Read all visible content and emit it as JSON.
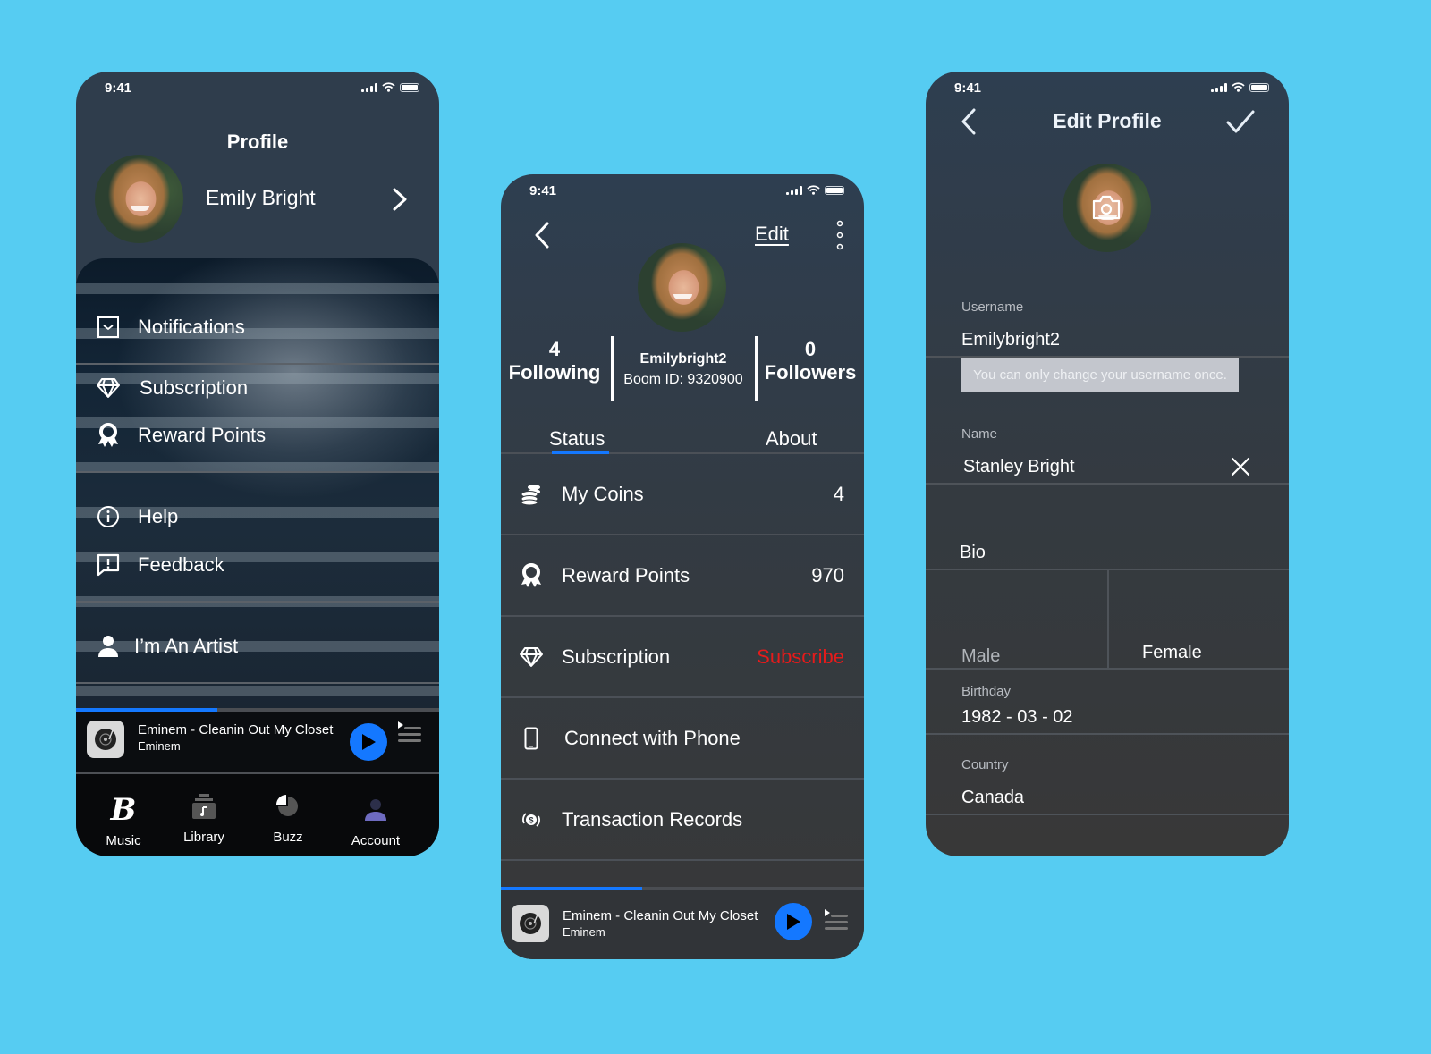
{
  "status_bar": {
    "time": "9:41"
  },
  "accent_colors": {
    "background": "#56CCF2",
    "primary": "#1478FF",
    "danger": "#E51B1B"
  },
  "profile_screen": {
    "title": "Profile",
    "user_name": "Emily Bright",
    "menu": [
      {
        "label": "Notifications",
        "icon": "mail-icon"
      },
      {
        "label": "Subscription",
        "icon": "diamond-icon"
      },
      {
        "label": "Reward Points",
        "icon": "award-icon"
      },
      {
        "label": "Help",
        "icon": "info-icon"
      },
      {
        "label": "Feedback",
        "icon": "feedback-icon"
      },
      {
        "label": "I’m An Artist",
        "icon": "person-icon"
      }
    ],
    "player": {
      "title": "Eminem - Cleanin Out My Closet",
      "artist": "Eminem",
      "progress": 0.39
    },
    "nav": [
      {
        "label": "Music",
        "icon": "boom-logo-icon"
      },
      {
        "label": "Library",
        "icon": "library-icon"
      },
      {
        "label": "Buzz",
        "icon": "pie-icon"
      },
      {
        "label": "Account",
        "icon": "account-icon",
        "active": true
      }
    ]
  },
  "account_screen": {
    "edit_label": "Edit",
    "following_count": "4",
    "following_label": "Following",
    "followers_count": "0",
    "followers_label": "Followers",
    "username": "Emilybright2",
    "boom_id": "Boom ID: 9320900",
    "tabs": [
      {
        "label": "Status",
        "active": true
      },
      {
        "label": "About"
      }
    ],
    "rows": [
      {
        "label": "My Coins",
        "value": "4",
        "icon": "coins-icon"
      },
      {
        "label": "Reward Points",
        "value": "970",
        "icon": "award-icon"
      },
      {
        "label": "Subscription",
        "value": "Subscribe",
        "icon": "diamond-icon"
      },
      {
        "label": "Connect with Phone",
        "value": "",
        "icon": "phone-icon"
      },
      {
        "label": "Transaction Records",
        "value": "",
        "icon": "transaction-icon"
      }
    ],
    "player": {
      "title": "Eminem - Cleanin Out My Closet",
      "artist": "Eminem",
      "progress": 0.39
    }
  },
  "edit_profile_screen": {
    "title": "Edit Profile",
    "username_label": "Username",
    "username_value": "Emilybright2",
    "username_hint": "You can only change your username once.",
    "name_label": "Name",
    "name_value": "Stanley Bright",
    "bio_label": "Bio",
    "gender_options": [
      "Male",
      "Female"
    ],
    "birthday_label": "Birthday",
    "birthday_value": "1982 - 03 - 02",
    "country_label": "Country",
    "country_value": "Canada"
  }
}
